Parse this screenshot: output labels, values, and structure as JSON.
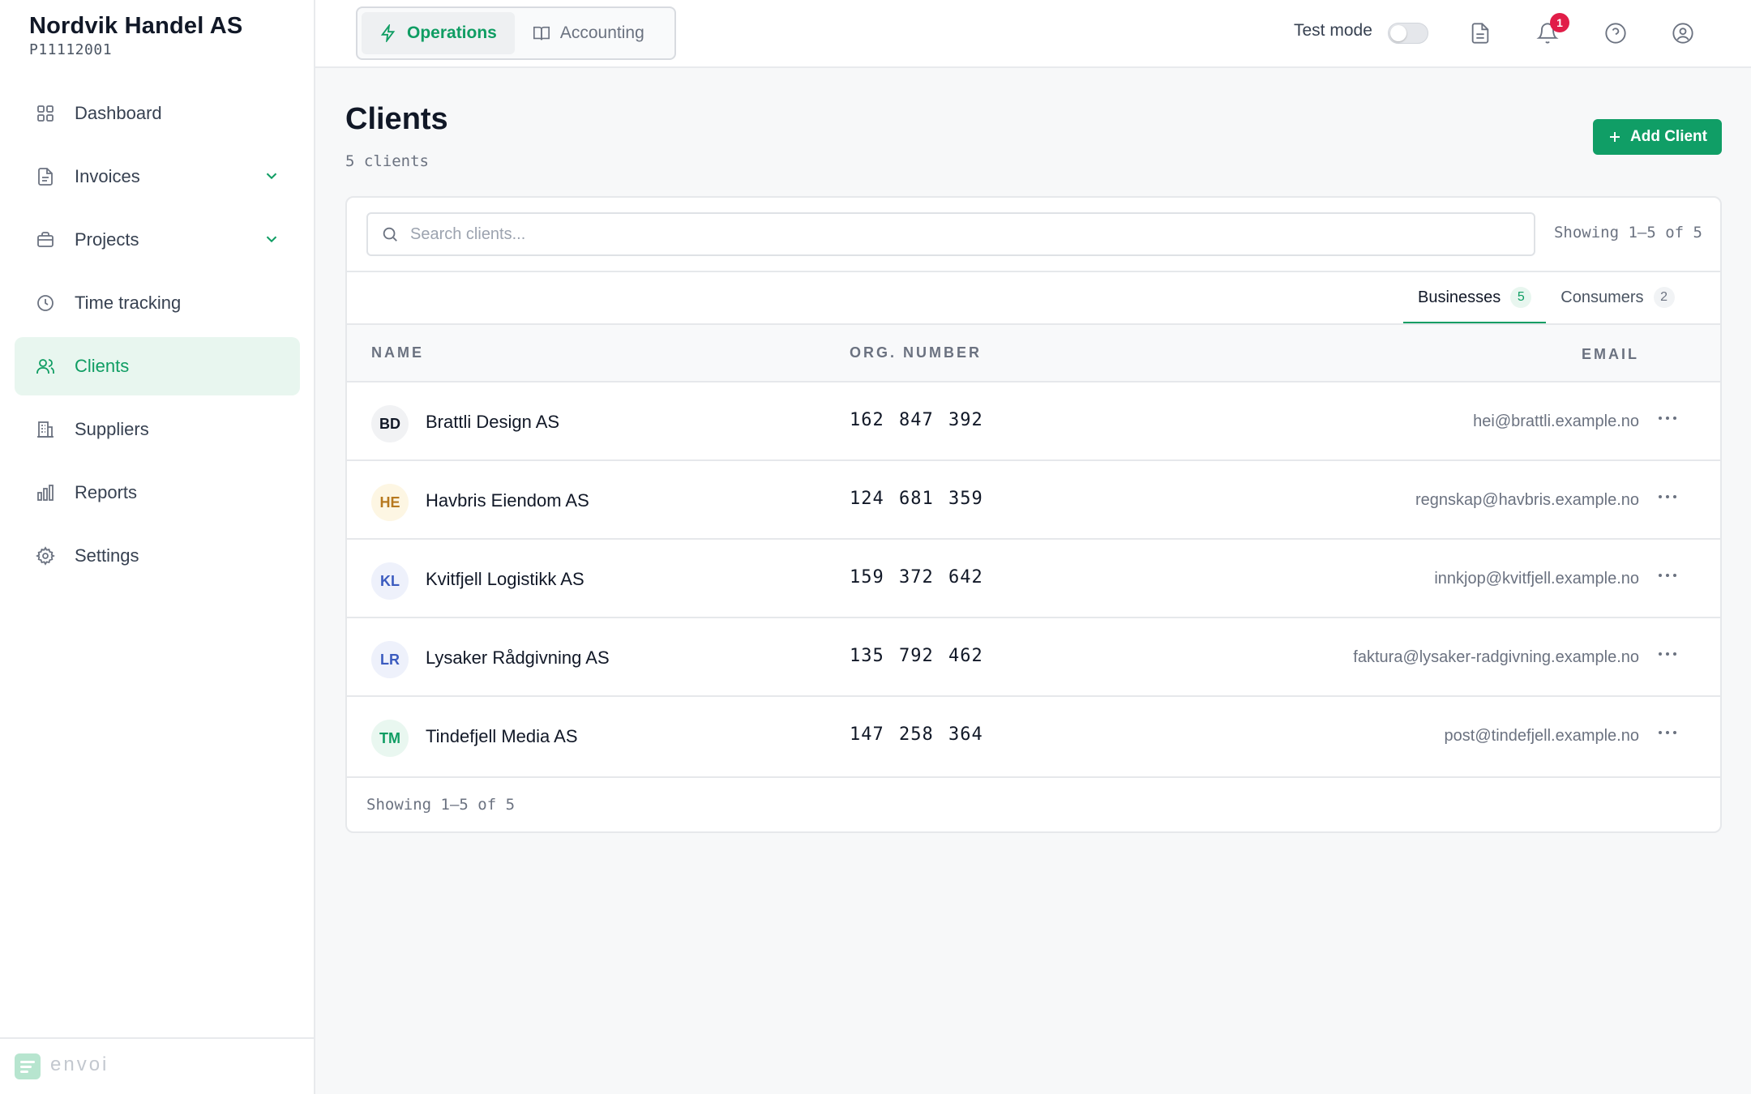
{
  "company": {
    "name": "Nordvik Handel AS",
    "id": "P11112001"
  },
  "sidebar": {
    "items": [
      {
        "label": "Dashboard",
        "icon": "dashboard-grid-icon"
      },
      {
        "label": "Invoices",
        "icon": "file-icon",
        "expandable": true
      },
      {
        "label": "Projects",
        "icon": "briefcase-icon",
        "expandable": true
      },
      {
        "label": "Time tracking",
        "icon": "clock-icon"
      },
      {
        "label": "Clients",
        "icon": "users-icon",
        "active": true
      },
      {
        "label": "Suppliers",
        "icon": "building-icon"
      },
      {
        "label": "Reports",
        "icon": "bar-chart-icon"
      },
      {
        "label": "Settings",
        "icon": "gear-icon"
      }
    ],
    "brand": "envoi"
  },
  "topbar": {
    "modes": [
      {
        "label": "Operations",
        "icon": "lightning-icon",
        "active": true
      },
      {
        "label": "Accounting",
        "icon": "book-icon",
        "active": false
      }
    ],
    "test_mode_label": "Test mode",
    "test_mode_on": false,
    "notification_count": "1"
  },
  "page": {
    "title": "Clients",
    "count_text": "5 clients",
    "add_button_label": "Add Client"
  },
  "search": {
    "placeholder": "Search clients...",
    "value": ""
  },
  "pagination": {
    "showing_text": "Showing 1–5 of 5"
  },
  "tabs": [
    {
      "label": "Businesses",
      "count": "5",
      "active": true
    },
    {
      "label": "Consumers",
      "count": "2",
      "active": false
    }
  ],
  "table": {
    "headers": {
      "name": "NAME",
      "org": "ORG. NUMBER",
      "email": "EMAIL"
    },
    "rows": [
      {
        "initials": "BD",
        "name": "Brattli Design AS",
        "org": "162 847 392",
        "email": "hei@brattli.example.no"
      },
      {
        "initials": "HE",
        "name": "Havbris Eiendom AS",
        "org": "124 681 359",
        "email": "regnskap@havbris.example.no"
      },
      {
        "initials": "KL",
        "name": "Kvitfjell Logistikk AS",
        "org": "159 372 642",
        "email": "innkjop@kvitfjell.example.no"
      },
      {
        "initials": "LR",
        "name": "Lysaker Rådgivning AS",
        "org": "135 792 462",
        "email": "faktura@lysaker-radgivning.example.no"
      },
      {
        "initials": "TM",
        "name": "Tindefjell Media AS",
        "org": "147 258 364",
        "email": "post@tindefjell.example.no"
      }
    ]
  },
  "colors": {
    "accent": "#0f9d63",
    "avatar_bd": "#f1f2f4",
    "avatar_he": "#fdf6e3",
    "avatar_he_text": "#b7791f",
    "avatar_kl_lr": "#eef1fb",
    "avatar_kl_lr_text": "#3b5bbf",
    "avatar_tm": "#e9f7f0",
    "badge": "#e11d48"
  }
}
